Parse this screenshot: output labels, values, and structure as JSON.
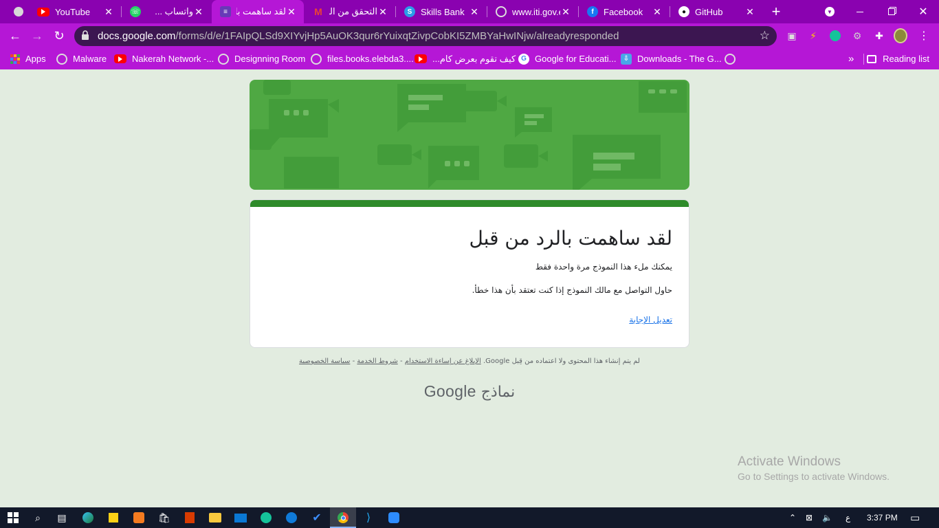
{
  "browser": {
    "tabs": [
      {
        "title": "YouTube",
        "icon": "youtube-icon",
        "rtl": false
      },
      {
        "title": "واتساب ...",
        "icon": "whatsapp-icon",
        "rtl": true
      },
      {
        "title": "لقد ساهمت با",
        "icon": "google-forms-icon",
        "rtl": true,
        "active": true
      },
      {
        "title": "التحقق من الب",
        "icon": "gmail-icon",
        "rtl": true
      },
      {
        "title": "Skills Bank",
        "icon": "skills-bank-icon",
        "rtl": false
      },
      {
        "title": "www.iti.gov.e",
        "icon": "globe-icon",
        "rtl": false
      },
      {
        "title": "Facebook",
        "icon": "facebook-icon",
        "rtl": false
      },
      {
        "title": "GitHub",
        "icon": "github-icon",
        "rtl": false
      }
    ],
    "close_glyph": "✕",
    "new_tab_glyph": "+",
    "url_host": "docs.google.com",
    "url_path": "/forms/d/e/1FAIpQLSd9XIYvjHp5AuOK3qur6rYuixqtZivpCobKI5ZMBYaHwINjw/alreadyresponded",
    "bookmarks": [
      {
        "label": "Apps",
        "icon": "apps-grid-icon"
      },
      {
        "label": "Malware",
        "icon": "globe-icon"
      },
      {
        "label": "Nakerah Network -...",
        "icon": "youtube-icon"
      },
      {
        "label": "Designning Room",
        "icon": "globe-icon"
      },
      {
        "label": "files.books.elebda3....",
        "icon": "globe-icon"
      },
      {
        "label": "كيف تقوم بعرض كام...",
        "icon": "youtube-icon"
      },
      {
        "label": "Google for Educati...",
        "icon": "google-icon"
      },
      {
        "label": "Downloads - The G...",
        "icon": "downloads-icon"
      }
    ],
    "more_bookmarks": "»",
    "reading_list": "Reading list"
  },
  "form": {
    "title": "لقد ساهمت بالرد من قبل",
    "line1": "يمكنك ملء هذا النموذج مرة واحدة فقط",
    "line2": "حاول التواصل مع مالك النموذج إذا كنت تعتقد بأن هذا خطأ.",
    "edit_link": "تعديل الإجابة"
  },
  "footer": {
    "disclaimer": "لم يتم إنشاء هذا المحتوى ولا اعتماده من قِبل Google.",
    "report_link": "الإبلاغ عن إساءة الاستخدام",
    "sep": " - ",
    "terms_link": "شروط الخدمة",
    "privacy_link": "سياسة الخصوصية",
    "logo_google": "Google",
    "logo_forms": "نماذج"
  },
  "watermark": {
    "line1": "Activate Windows",
    "line2": "Go to Settings to activate Windows."
  },
  "taskbar": {
    "lang": "ع",
    "time": "3:37 PM"
  },
  "colors": {
    "tabstrip": "#8a02b0",
    "toolbar": "#b517d6",
    "banner_green": "#4fa843",
    "form_accent": "#2e8b2a",
    "page_bg": "#e2ece0"
  }
}
